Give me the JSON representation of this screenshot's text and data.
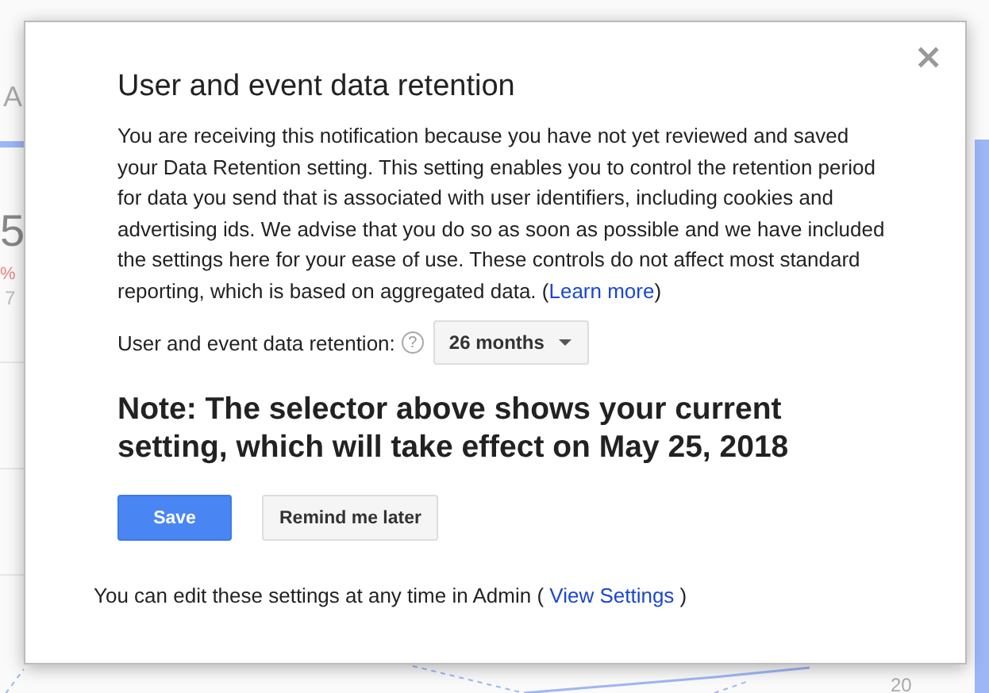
{
  "background": {
    "tab_label": "A",
    "metric_value": "5",
    "metric_change": "%",
    "metric_note": "7",
    "axis_label": "20"
  },
  "dialog": {
    "title": "User and event data retention",
    "close": "×",
    "paragraph": {
      "before": "You are receiving this notification because you have not yet reviewed and saved your Data Retention setting. This setting enables you to control the retention period for data you send that is associated with user identifiers, including cookies and advertising ids. We advise that you do so as soon as possible and we have included the settings here for your ease of use. These controls do not affect most standard reporting, which is based on aggregated data. (",
      "link": "Learn more",
      "after": ")"
    },
    "retention": {
      "label": "User and event data retention:",
      "help": "?",
      "value": "26 months"
    },
    "note": "Note: The selector above shows your current setting, which will take effect on May 25, 2018",
    "buttons": [
      {
        "label": "Save",
        "kind": "primary"
      },
      {
        "label": "Remind me later",
        "kind": "secondary"
      }
    ],
    "footer": {
      "before": "You can edit these settings at any time in Admin (",
      "link": "View Settings",
      "after": ")"
    }
  }
}
